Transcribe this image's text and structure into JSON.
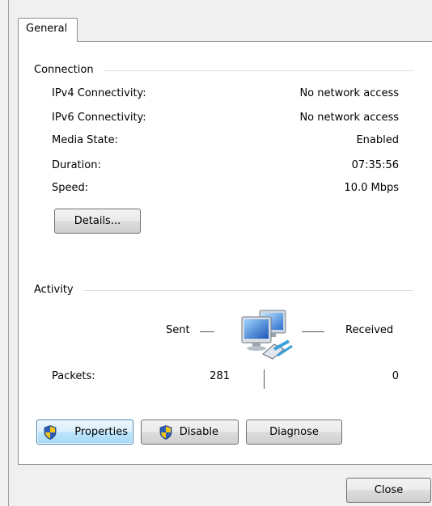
{
  "tabs": [
    {
      "label": "General",
      "selected": true
    }
  ],
  "connection": {
    "title": "Connection",
    "rows": [
      {
        "label": "IPv4 Connectivity:",
        "value": "No network access"
      },
      {
        "label": "IPv6 Connectivity:",
        "value": "No network access"
      },
      {
        "label": "Media State:",
        "value": "Enabled"
      },
      {
        "label": "Duration:",
        "value": "07:35:56"
      },
      {
        "label": "Speed:",
        "value": "10.0 Mbps"
      }
    ],
    "details_button": "Details..."
  },
  "activity": {
    "title": "Activity",
    "sent_label": "Sent",
    "received_label": "Received",
    "packets_label": "Packets:",
    "packets_sent": "281",
    "packets_received": "0",
    "network_icon": "network-computers-icon"
  },
  "buttons": {
    "properties": "Properties",
    "disable": "Disable",
    "diagnose": "Diagnose",
    "close": "Close"
  },
  "colors": {
    "tab_border": "#898c95",
    "focus_blue": "#3c7fb1",
    "shield_blue": "#2d5eb8",
    "shield_yellow": "#f5c518"
  }
}
